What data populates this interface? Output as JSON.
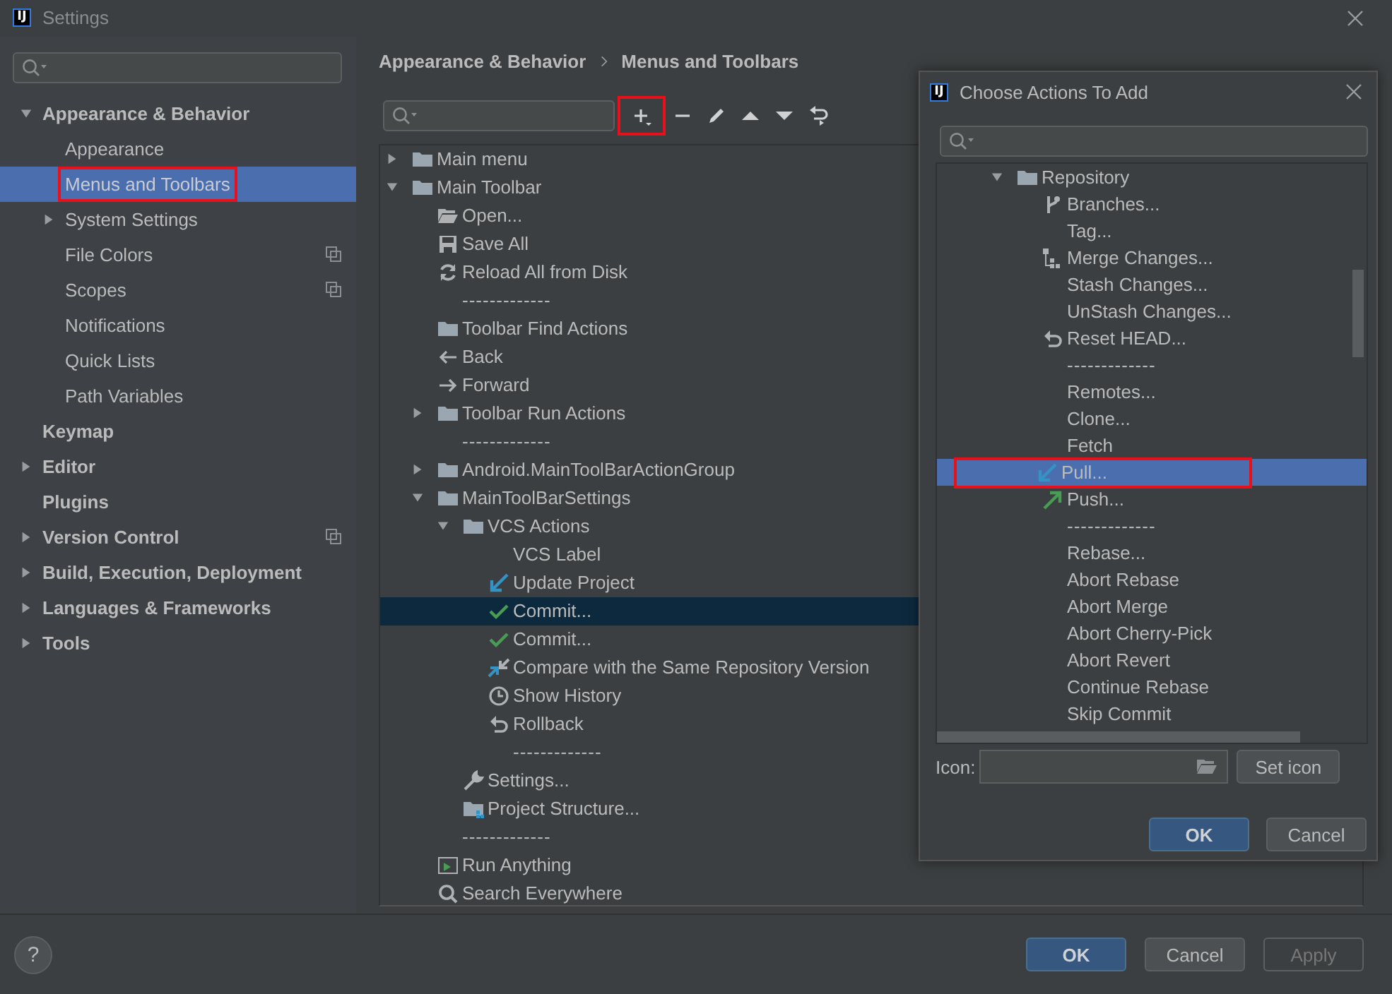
{
  "window": {
    "logo": "IJ",
    "title": "Settings"
  },
  "sidebar": {
    "items": [
      {
        "label": "Appearance & Behavior",
        "expanded": true,
        "selected": false,
        "highlighted": false,
        "children": [
          {
            "label": "Appearance",
            "selected": false,
            "highlighted": false
          },
          {
            "label": "Menus and Toolbars",
            "selected": true,
            "highlighted": true
          },
          {
            "label": "System Settings",
            "expanded": false,
            "selected": false,
            "highlighted": false
          },
          {
            "label": "File Colors",
            "selected": false,
            "highlighted": false,
            "project_level": true
          },
          {
            "label": "Scopes",
            "selected": false,
            "highlighted": false,
            "project_level": true
          },
          {
            "label": "Notifications",
            "selected": false,
            "highlighted": false
          },
          {
            "label": "Quick Lists",
            "selected": false,
            "highlighted": false
          },
          {
            "label": "Path Variables",
            "selected": false,
            "highlighted": false
          }
        ]
      },
      {
        "label": "Keymap",
        "selected": false,
        "highlighted": false
      },
      {
        "label": "Editor",
        "expanded": false,
        "selected": false,
        "highlighted": false
      },
      {
        "label": "Plugins",
        "selected": false,
        "highlighted": false
      },
      {
        "label": "Version Control",
        "expanded": false,
        "selected": false,
        "highlighted": false,
        "project_level": true
      },
      {
        "label": "Build, Execution, Deployment",
        "expanded": false,
        "selected": false,
        "highlighted": false
      },
      {
        "label": "Languages & Frameworks",
        "expanded": false,
        "selected": false,
        "highlighted": false
      },
      {
        "label": "Tools",
        "expanded": false,
        "selected": false,
        "highlighted": false
      }
    ]
  },
  "breadcrumb": [
    "Appearance & Behavior",
    "Menus and Toolbars"
  ],
  "toolbar": {
    "buttons": [
      {
        "kind": "add",
        "highlighted": true
      },
      {
        "kind": "remove",
        "highlighted": false
      },
      {
        "kind": "edit",
        "highlighted": false
      },
      {
        "kind": "move_up",
        "highlighted": false
      },
      {
        "kind": "move_down",
        "highlighted": false
      },
      {
        "kind": "restore",
        "highlighted": false
      }
    ]
  },
  "tree": {
    "items": [
      {
        "label": "Main menu",
        "kind": "folder",
        "expanded": false,
        "selected": false
      },
      {
        "label": "Main Toolbar",
        "kind": "folder",
        "expanded": true,
        "selected": false,
        "children": [
          {
            "label": "Open...",
            "kind": "open",
            "selected": false
          },
          {
            "label": "Save All",
            "kind": "save",
            "selected": false
          },
          {
            "label": "Reload All from Disk",
            "kind": "reload",
            "selected": false
          },
          {
            "label": "-------------",
            "kind": "separator",
            "selected": false
          },
          {
            "label": "Toolbar Find Actions",
            "kind": "folder",
            "selected": false
          },
          {
            "label": "Back",
            "kind": "back",
            "selected": false
          },
          {
            "label": "Forward",
            "kind": "forward",
            "selected": false
          },
          {
            "label": "Toolbar Run Actions",
            "kind": "folder",
            "expanded": false,
            "selected": false
          },
          {
            "label": "-------------",
            "kind": "separator",
            "selected": false
          },
          {
            "label": "Android.MainToolBarActionGroup",
            "kind": "folder",
            "expanded": false,
            "selected": false
          },
          {
            "label": "MainToolBarSettings",
            "kind": "folder",
            "expanded": true,
            "selected": false,
            "children": [
              {
                "label": "VCS Actions",
                "kind": "folder",
                "expanded": true,
                "selected": false,
                "children": [
                  {
                    "label": "VCS Label",
                    "kind": "plain",
                    "selected": false
                  },
                  {
                    "label": "Update Project",
                    "kind": "update",
                    "selected": false
                  },
                  {
                    "label": "Commit...",
                    "kind": "commit",
                    "selected": true
                  },
                  {
                    "label": "Commit...",
                    "kind": "commit",
                    "selected": false
                  },
                  {
                    "label": "Compare with the Same Repository Version",
                    "kind": "compare",
                    "selected": false
                  },
                  {
                    "label": "Show History",
                    "kind": "history",
                    "selected": false
                  },
                  {
                    "label": "Rollback",
                    "kind": "rollback",
                    "selected": false
                  },
                  {
                    "label": "-------------",
                    "kind": "separator",
                    "selected": false
                  }
                ]
              },
              {
                "label": "Settings...",
                "kind": "wrench",
                "selected": false
              },
              {
                "label": "Project Structure...",
                "kind": "project",
                "selected": false
              }
            ]
          },
          {
            "label": "-------------",
            "kind": "separator",
            "selected": false
          },
          {
            "label": "Run Anything",
            "kind": "run",
            "selected": false
          },
          {
            "label": "Search Everywhere",
            "kind": "search",
            "selected": false
          }
        ]
      }
    ]
  },
  "dialog": {
    "logo": "IJ",
    "title": "Choose Actions To Add",
    "tree": [
      {
        "label": "Repository",
        "kind": "folder",
        "expanded": true,
        "selected": false,
        "highlighted": false,
        "children": [
          {
            "label": "Branches...",
            "kind": "branch",
            "selected": false,
            "highlighted": false
          },
          {
            "label": "Tag...",
            "kind": "plain",
            "selected": false,
            "highlighted": false
          },
          {
            "label": "Merge Changes...",
            "kind": "merge",
            "selected": false,
            "highlighted": false
          },
          {
            "label": "Stash Changes...",
            "kind": "plain",
            "selected": false,
            "highlighted": false
          },
          {
            "label": "UnStash Changes...",
            "kind": "plain",
            "selected": false,
            "highlighted": false
          },
          {
            "label": "Reset HEAD...",
            "kind": "reset",
            "selected": false,
            "highlighted": false
          },
          {
            "label": "-------------",
            "kind": "separator",
            "selected": false,
            "highlighted": false
          },
          {
            "label": "Remotes...",
            "kind": "plain",
            "selected": false,
            "highlighted": false
          },
          {
            "label": "Clone...",
            "kind": "plain",
            "selected": false,
            "highlighted": false
          },
          {
            "label": "Fetch",
            "kind": "plain",
            "selected": false,
            "highlighted": false
          },
          {
            "label": "Pull...",
            "kind": "pull",
            "selected": true,
            "highlighted": true
          },
          {
            "label": "Push...",
            "kind": "push",
            "selected": false,
            "highlighted": false
          },
          {
            "label": "-------------",
            "kind": "separator",
            "selected": false,
            "highlighted": false
          },
          {
            "label": "Rebase...",
            "kind": "plain",
            "selected": false,
            "highlighted": false
          },
          {
            "label": "Abort Rebase",
            "kind": "plain",
            "selected": false,
            "highlighted": false
          },
          {
            "label": "Abort Merge",
            "kind": "plain",
            "selected": false,
            "highlighted": false
          },
          {
            "label": "Abort Cherry-Pick",
            "kind": "plain",
            "selected": false,
            "highlighted": false
          },
          {
            "label": "Abort Revert",
            "kind": "plain",
            "selected": false,
            "highlighted": false
          },
          {
            "label": "Continue Rebase",
            "kind": "plain",
            "selected": false,
            "highlighted": false
          },
          {
            "label": "Skip Commit",
            "kind": "plain",
            "selected": false,
            "highlighted": false
          }
        ]
      }
    ],
    "icon_label": "Icon:",
    "set_icon_button": "Set icon",
    "buttons": [
      {
        "label": "OK",
        "default": true
      },
      {
        "label": "Cancel",
        "default": false
      }
    ]
  },
  "help_button": "?",
  "buttons": [
    {
      "label": "OK",
      "default": true,
      "disabled": false
    },
    {
      "label": "Cancel",
      "default": false,
      "disabled": false
    },
    {
      "label": "Apply",
      "default": false,
      "disabled": true
    }
  ]
}
